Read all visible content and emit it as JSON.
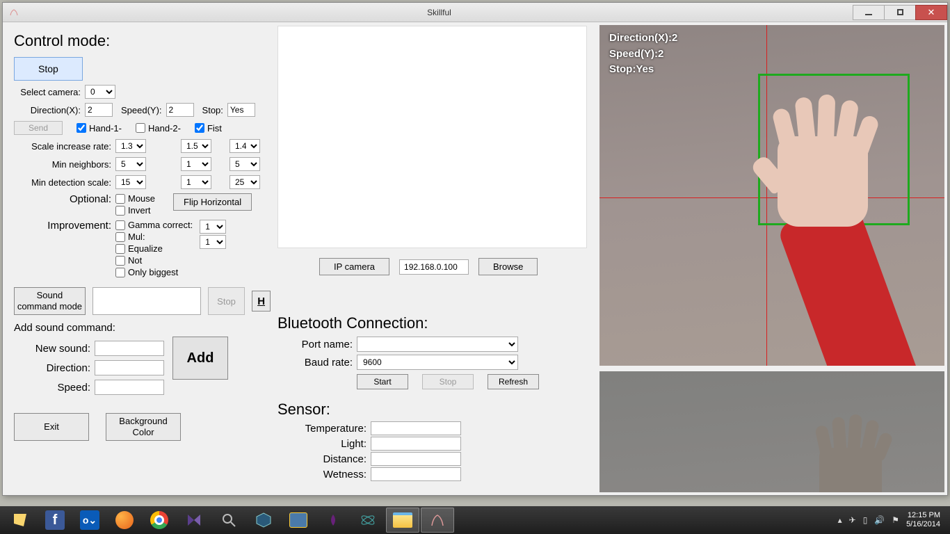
{
  "window": {
    "title": "Skillful"
  },
  "control": {
    "heading": "Control mode:",
    "stop_btn": "Stop",
    "select_camera_label": "Select camera:",
    "select_camera_value": "0",
    "direction_label": "Direction(X):",
    "direction_value": "2",
    "speed_label": "Speed(Y):",
    "speed_value": "2",
    "stop_label": "Stop:",
    "stop_value": "Yes",
    "send_btn": "Send",
    "hand1_label": "Hand-1-",
    "hand1_checked": true,
    "hand2_label": "Hand-2-",
    "hand2_checked": false,
    "fist_label": "Fist",
    "fist_checked": true,
    "scale_label": "Scale increase rate:",
    "scale_v": [
      "1.3",
      "1.5",
      "1.4"
    ],
    "minn_label": "Min neighbors:",
    "minn_v": [
      "5",
      "1",
      "5"
    ],
    "mind_label": "Min detection scale:",
    "mind_v": [
      "15",
      "1",
      "25"
    ],
    "optional_label": "Optional:",
    "mouse_label": "Mouse",
    "invert_label": "Invert",
    "flip_btn": "Flip Horizontal",
    "improvement_label": "Improvement:",
    "gamma_label": "Gamma correct:",
    "gamma_v": "1",
    "mul_label": "Mul:",
    "mul_v": "1",
    "equalize_label": "Equalize",
    "not_label": "Not",
    "only_biggest_label": "Only biggest",
    "sound_mode_btn": "Sound\ncommand mode",
    "sound_stop_btn": "Stop",
    "h_btn": "H",
    "add_sound_heading": "Add sound command:",
    "new_sound_label": "New sound:",
    "dir_label": "Direction:",
    "spd_label": "Speed:",
    "add_btn": "Add",
    "exit_btn": "Exit",
    "bgcolor_btn": "Background\nColor"
  },
  "ip": {
    "ipcam_btn": "IP camera",
    "ip_value": "192.168.0.100",
    "browse_btn": "Browse"
  },
  "bt": {
    "heading": "Bluetooth Connection:",
    "port_label": "Port name:",
    "port_value": "",
    "baud_label": "Baud rate:",
    "baud_value": "9600",
    "start_btn": "Start",
    "stop_btn": "Stop",
    "refresh_btn": "Refresh"
  },
  "sensor": {
    "heading": "Sensor:",
    "temp_label": "Temperature:",
    "light_label": "Light:",
    "dist_label": "Distance:",
    "wet_label": "Wetness:"
  },
  "overlay": {
    "l1": "Direction(X):2",
    "l2": "Speed(Y):2",
    "l3": "Stop:Yes"
  },
  "tray": {
    "time": "12:15 PM",
    "date": "5/16/2014"
  }
}
